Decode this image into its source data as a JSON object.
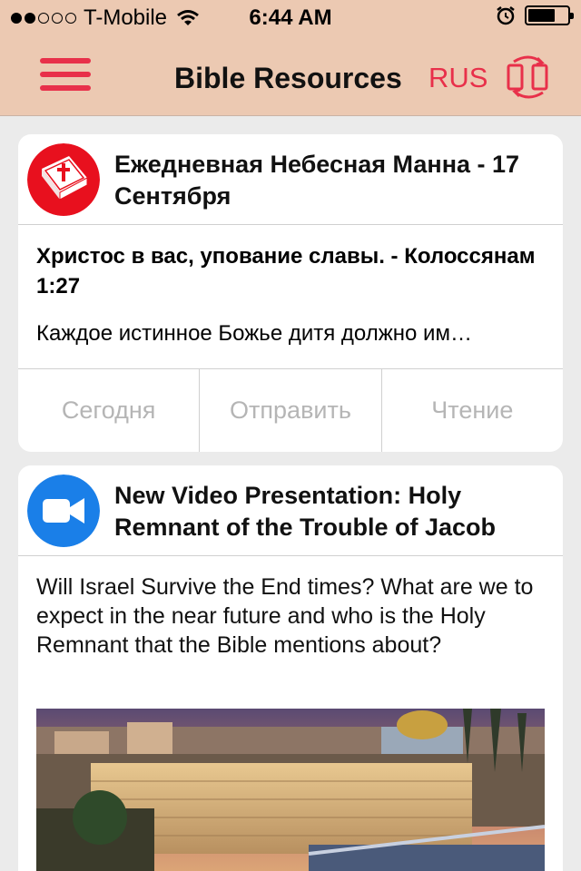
{
  "status_bar": {
    "carrier": "T-Mobile",
    "time": "6:44 AM",
    "signal_bars_filled": 2,
    "signal_bars_total": 5
  },
  "nav": {
    "title": "Bible Resources",
    "language": "RUS",
    "accent_color": "#e8304a"
  },
  "cards": [
    {
      "icon": "bible-book-icon",
      "title": "Ежедневная Небесная Манна - 17 Сентября",
      "verse": "Христос в вас, упование славы. - Колоссянам 1:27",
      "excerpt": "Каждое истинное Божье дитя должно им…",
      "actions": [
        "Сегодня",
        "Отправить",
        "Чтение"
      ]
    },
    {
      "icon": "video-camera-icon",
      "title": "New Video Presentation: Holy Remnant of the Trouble of Jacob",
      "description": "Will Israel Survive the End times? What are we to expect in the near future and who is the  Holy Remnant  that the Bible mentions about?"
    }
  ]
}
